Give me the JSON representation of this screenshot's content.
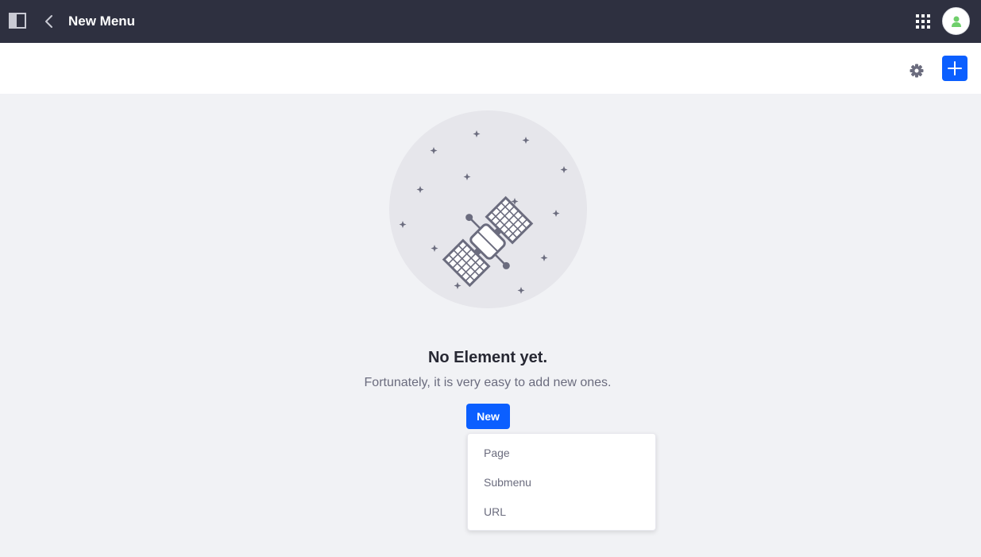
{
  "header": {
    "title": "New Menu",
    "icons": {
      "sidebar_toggle": "sidebar-toggle-icon",
      "back": "chevron-left-icon",
      "apps": "grid-icon",
      "avatar": "user-icon"
    }
  },
  "toolbar": {
    "icons": {
      "settings": "gear-icon",
      "add": "plus-icon"
    }
  },
  "empty_state": {
    "title": "No Element yet.",
    "description": "Fortunately, it is very easy to add new ones.",
    "illustration": "satellite-illustration"
  },
  "new_button": {
    "label": "New"
  },
  "dropdown": {
    "items": [
      {
        "label": "Page"
      },
      {
        "label": "Submenu"
      },
      {
        "label": "URL"
      }
    ]
  },
  "colors": {
    "topbar": "#2e3040",
    "primary": "#0b5fff",
    "background": "#f1f2f5",
    "avatar_icon": "#6fcf6b"
  }
}
